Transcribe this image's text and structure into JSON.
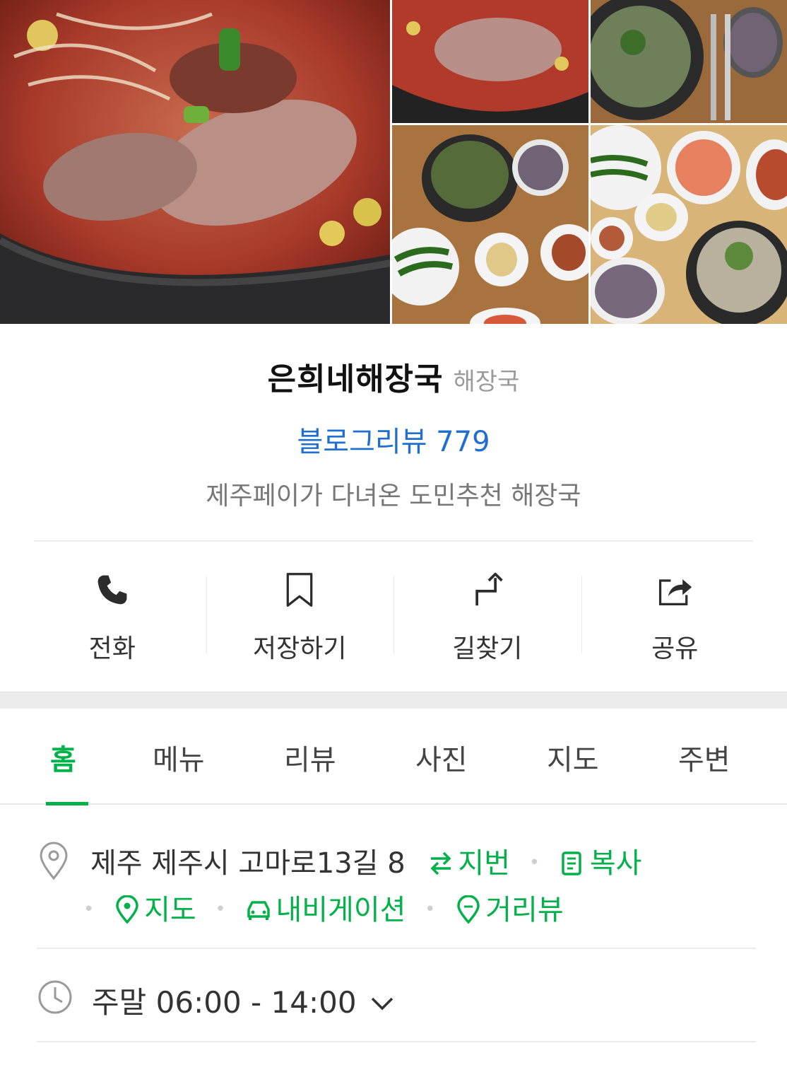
{
  "place": {
    "name": "은희네해장국",
    "category": "해장국",
    "review_link": "블로그리뷰 779",
    "description": "제주페이가 다녀온 도민추천 해장국"
  },
  "actions": [
    {
      "label": "전화",
      "icon": "phone-icon"
    },
    {
      "label": "저장하기",
      "icon": "bookmark-icon"
    },
    {
      "label": "길찾기",
      "icon": "directions-icon"
    },
    {
      "label": "공유",
      "icon": "share-icon"
    }
  ],
  "tabs": [
    {
      "label": "홈",
      "active": true
    },
    {
      "label": "메뉴"
    },
    {
      "label": "리뷰"
    },
    {
      "label": "사진"
    },
    {
      "label": "지도"
    },
    {
      "label": "주변"
    }
  ],
  "address": {
    "text": "제주 제주시 고마로13길 8",
    "jibun": "지번",
    "copy": "복사",
    "map": "지도",
    "navigation": "내비게이션",
    "street_view": "거리뷰"
  },
  "hours": {
    "text": "주말 06:00 - 14:00"
  },
  "colors": {
    "accent_green": "#03b14a",
    "link_blue": "#1e6fd1"
  }
}
